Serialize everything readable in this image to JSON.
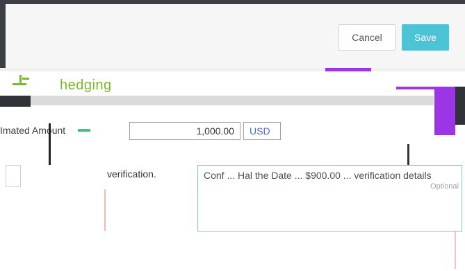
{
  "header": {
    "cancel_label": "Cancel",
    "save_label": "Save"
  },
  "logo": {
    "text": "hedging"
  },
  "form": {
    "amount_label": "Imated Amount",
    "amount_value": "1,000.00",
    "currency": "USD",
    "notes_text": "Conf ... Hal the Date ... $900.00 ... verification details",
    "notes_optional": "Optional",
    "notes_verification": "verification."
  },
  "colors": {
    "accent": "#4dc3d6",
    "purple": "#9b35e6",
    "logo_green": "#7ab82f"
  }
}
